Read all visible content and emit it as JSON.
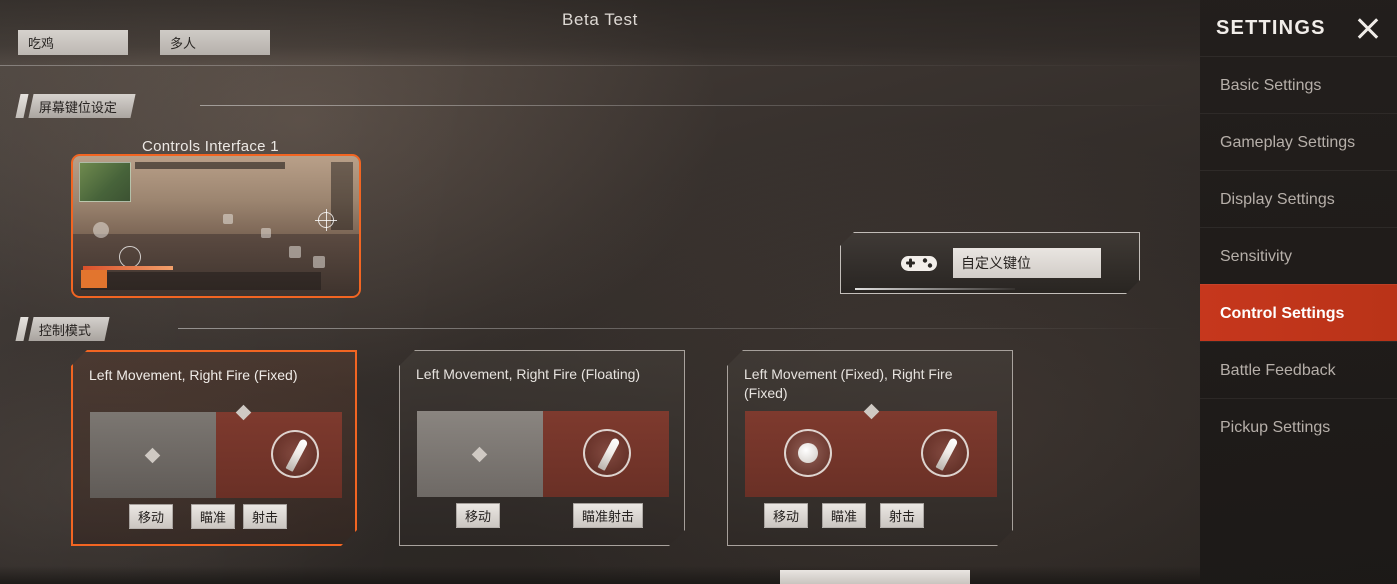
{
  "header": {
    "title": "Beta Test",
    "tabs": [
      {
        "label": "吃鸡"
      },
      {
        "label": "多人"
      }
    ]
  },
  "sections": {
    "screen_keys": {
      "label": "屏幕键位设定"
    },
    "control_mode": {
      "label": "控制模式"
    }
  },
  "controls_interface": {
    "label": "Controls Interface 1"
  },
  "custom_keys": {
    "icon": "gamepad-icon",
    "value": "自定义键位"
  },
  "control_modes": [
    {
      "title": "Left Movement, Right Fire (Fixed)",
      "selected": true,
      "labels": [
        "移动",
        "瞄准",
        "射击"
      ]
    },
    {
      "title": "Left Movement, Right Fire (Floating)",
      "selected": false,
      "labels": [
        "移动",
        "瞄准射击"
      ]
    },
    {
      "title": "Left Movement (Fixed), Right Fire (Fixed)",
      "selected": false,
      "labels": [
        "移动",
        "瞄准",
        "射击"
      ]
    }
  ],
  "settings": {
    "title": "SETTINGS",
    "close_icon": "close-icon",
    "items": [
      {
        "label": "Basic Settings",
        "active": false
      },
      {
        "label": "Gameplay Settings",
        "active": false
      },
      {
        "label": "Display Settings",
        "active": false
      },
      {
        "label": "Sensitivity",
        "active": false
      },
      {
        "label": "Control Settings",
        "active": true
      },
      {
        "label": "Battle Feedback",
        "active": false
      },
      {
        "label": "Pickup Settings",
        "active": false
      }
    ]
  },
  "colors": {
    "accent_orange": "#f26522",
    "active_red": "#c6371d",
    "panel_bg": "#221e1c"
  }
}
